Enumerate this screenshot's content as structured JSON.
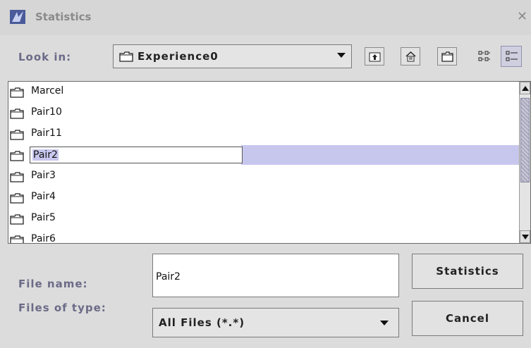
{
  "window": {
    "title": "Statistics"
  },
  "look_in": {
    "label": "Look in:",
    "value": "Experience0"
  },
  "toolbar": [
    "up-folder-icon",
    "home-icon",
    "new-folder-icon",
    "list-view-icon",
    "details-view-icon"
  ],
  "files": [
    {
      "name": "Marcel"
    },
    {
      "name": "Pair10"
    },
    {
      "name": "Pair11"
    },
    {
      "name": "Pair2",
      "selected": true,
      "editing": true
    },
    {
      "name": "Pair3"
    },
    {
      "name": "Pair4"
    },
    {
      "name": "Pair5"
    },
    {
      "name": "Pair6"
    }
  ],
  "file_name": {
    "label": "File name:",
    "value": "Pair2"
  },
  "files_of_type": {
    "label": "Files of type:",
    "value": "All Files (*.*)"
  },
  "buttons": {
    "approve": "Statistics",
    "cancel": "Cancel"
  },
  "colors": {
    "selection": "#c7c7ee",
    "label": "#6b6b88"
  }
}
